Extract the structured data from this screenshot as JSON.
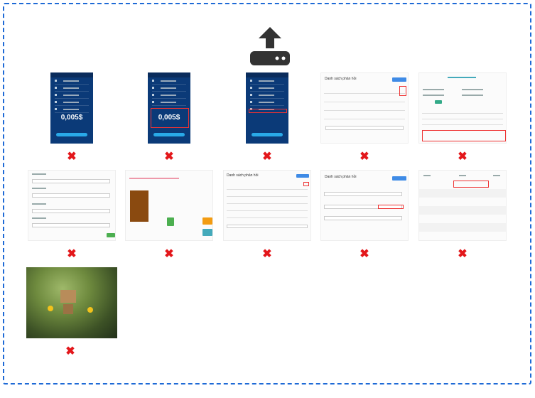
{
  "dropzone": {
    "upload_icon": "upload-server-icon",
    "border_color": "#1e6ad6",
    "remove_color": "#e3171b",
    "remove_glyph": "✖"
  },
  "thumbnails": [
    {
      "kind": "phone",
      "amount": "0,005$"
    },
    {
      "kind": "phone",
      "amount": "0,005$"
    },
    {
      "kind": "phone",
      "amount": ""
    },
    {
      "kind": "list",
      "title": "Danh sách phản hồi"
    },
    {
      "kind": "table",
      "title": ""
    },
    {
      "kind": "form",
      "title": ""
    },
    {
      "kind": "product",
      "title": ""
    },
    {
      "kind": "list",
      "title": "Danh sách phản hồi"
    },
    {
      "kind": "list",
      "title": "Danh sách phản hồi"
    },
    {
      "kind": "table",
      "title": ""
    },
    {
      "kind": "photo",
      "title": ""
    }
  ]
}
